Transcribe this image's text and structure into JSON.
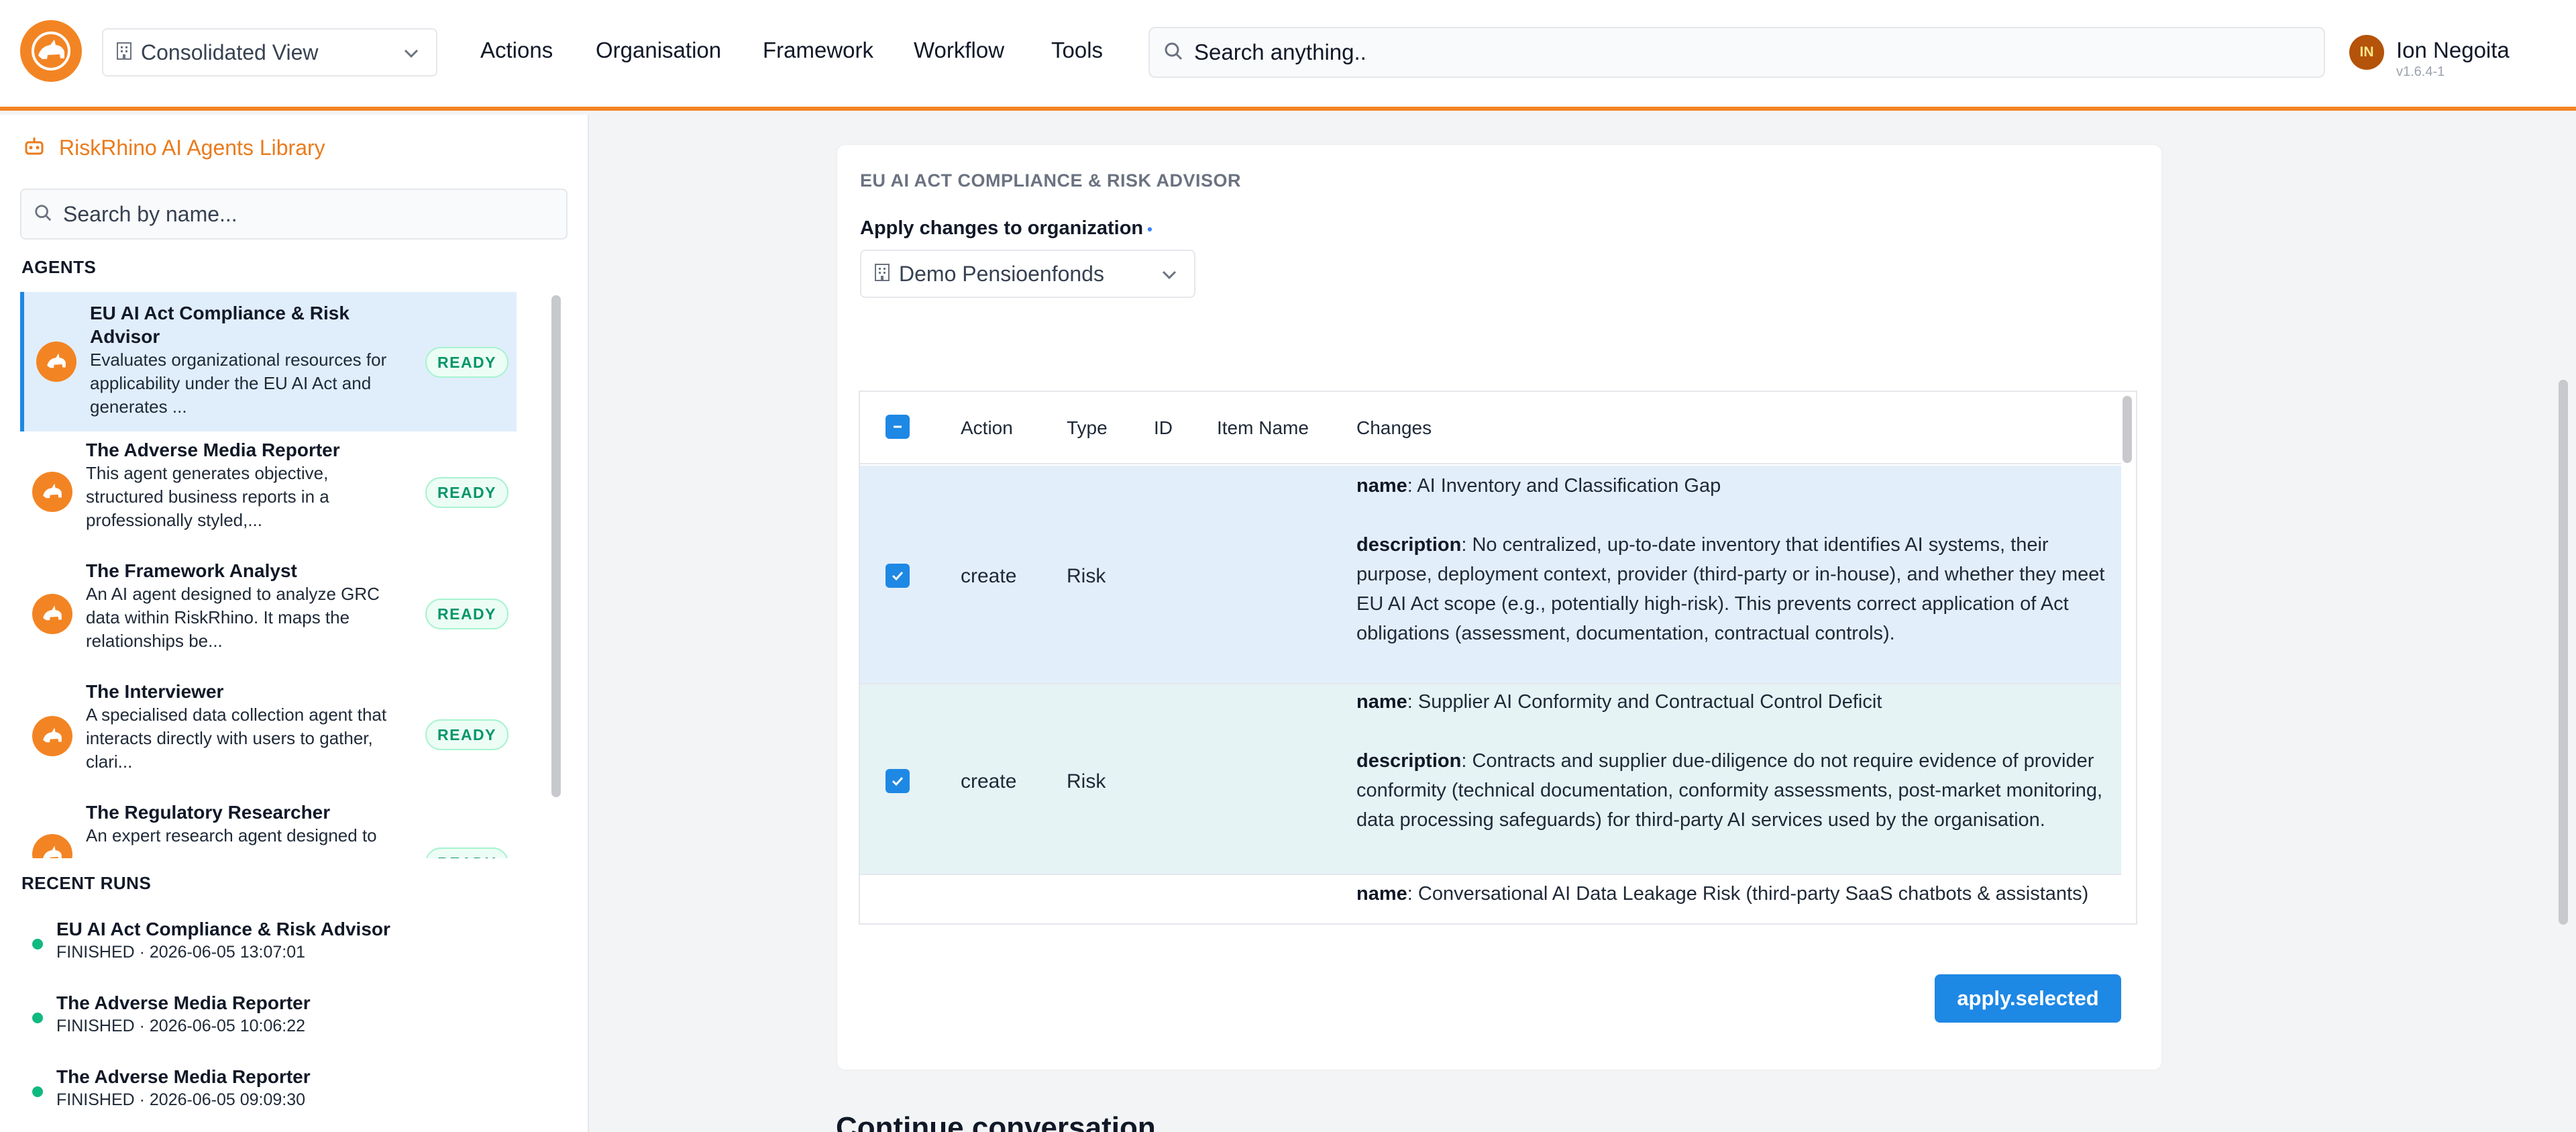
{
  "header": {
    "view_selector": "Consolidated View",
    "nav": [
      "Actions",
      "Organisation",
      "Framework",
      "Workflow",
      "Tools"
    ],
    "search_placeholder": "Search anything..",
    "user_initials": "IN",
    "user_name": "Ion Negoita",
    "version": "v1.6.4-1"
  },
  "sidebar": {
    "title": "RiskRhino AI Agents Library",
    "search_placeholder": "Search by name...",
    "agents_label": "AGENTS",
    "agents": [
      {
        "name_lines": [
          "EU AI Act Compliance & Risk",
          "Advisor"
        ],
        "desc_lines": [
          "Evaluates organizational resources for",
          "applicability under the EU AI Act and",
          "generates ..."
        ],
        "status": "READY"
      },
      {
        "name_lines": [
          "The Adverse Media Reporter"
        ],
        "desc_lines": [
          "This agent generates objective,",
          "structured business reports in a",
          "professionally styled,..."
        ],
        "status": "READY"
      },
      {
        "name_lines": [
          "The Framework Analyst"
        ],
        "desc_lines": [
          "An AI agent designed to analyze GRC",
          "data within RiskRhino. It maps the",
          "relationships be..."
        ],
        "status": "READY"
      },
      {
        "name_lines": [
          "The Interviewer"
        ],
        "desc_lines": [
          "A specialised data collection agent that",
          "interacts directly with users to gather,",
          "clari..."
        ],
        "status": "READY"
      },
      {
        "name_lines": [
          "The Regulatory Researcher"
        ],
        "desc_lines": [
          "An expert research agent designed to"
        ],
        "status": "READY"
      }
    ],
    "recent_label": "RECENT RUNS",
    "runs": [
      {
        "name": "EU AI Act Compliance & Risk Advisor",
        "status": "FINISHED · 2026-06-05 13:07:01"
      },
      {
        "name": "The Adverse Media Reporter",
        "status": "FINISHED · 2026-06-05 10:06:22"
      },
      {
        "name": "The Adverse Media Reporter",
        "status": "FINISHED · 2026-06-05 09:09:30"
      }
    ]
  },
  "main": {
    "card_title": "EU AI ACT COMPLIANCE & RISK ADVISOR",
    "apply_label": "Apply changes to organization",
    "apply_required": "•",
    "organization": "Demo Pensioenfonds",
    "table": {
      "headers": {
        "action": "Action",
        "type": "Type",
        "id": "ID",
        "item_name": "Item Name",
        "changes": "Changes"
      },
      "rows": [
        {
          "checked": true,
          "action": "create",
          "type": "Risk",
          "name_key": "name",
          "name": "AI Inventory and Classification Gap",
          "desc_key": "description",
          "description": "No centralized, up-to-date inventory that identifies AI systems, their purpose, deployment context, provider (third-party or in-house), and whether they meet EU AI Act scope (e.g., potentially high-risk). This prevents correct application of Act obligations (assessment, documentation, contractual controls)."
        },
        {
          "checked": true,
          "action": "create",
          "type": "Risk",
          "name_key": "name",
          "name": "Supplier AI Conformity and Contractual Control Deficit",
          "desc_key": "description",
          "description": "Contracts and supplier due-diligence do not require evidence of provider conformity (technical documentation, conformity assessments, post-market monitoring, data processing safeguards) for third-party AI services used by the organisation."
        },
        {
          "checked": false,
          "action": "",
          "type": "",
          "name_key": "name",
          "name": "Conversational AI Data Leakage Risk (third-party SaaS chatbots & assistants)",
          "desc_key": "",
          "description": ""
        }
      ]
    },
    "apply_button": "apply.selected",
    "continue_heading": "Continue conversation"
  },
  "colors": {
    "brand_orange": "#f38423",
    "accent_blue": "#1e88e5",
    "ready_green": "#059669"
  }
}
